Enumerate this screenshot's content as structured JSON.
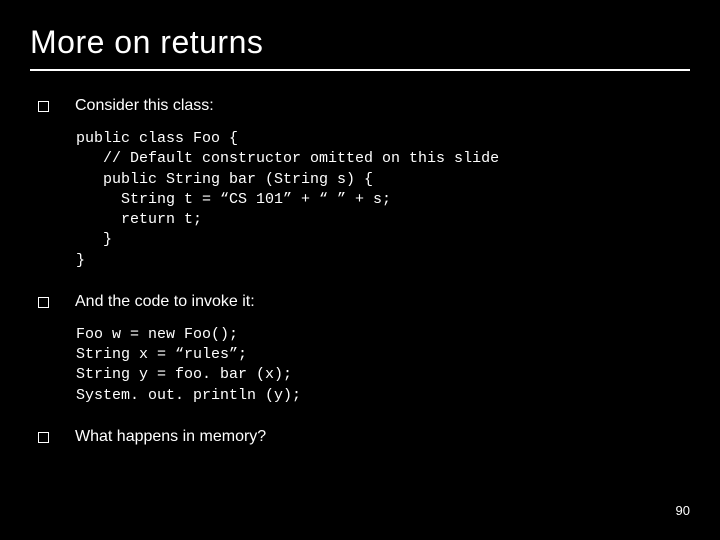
{
  "title": "More on returns",
  "bullets": [
    {
      "text": "Consider this class:"
    },
    {
      "text": "And the code to invoke it:"
    },
    {
      "text": "What happens in memory?"
    }
  ],
  "code1": "public class Foo {\n   // Default constructor omitted on this slide\n   public String bar (String s) {\n     String t = “CS 101” + “ ” + s;\n     return t;\n   }\n}",
  "code2": "Foo w = new Foo();\nString x = “rules”;\nString y = foo. bar (x);\nSystem. out. println (y);",
  "page_number": "90"
}
